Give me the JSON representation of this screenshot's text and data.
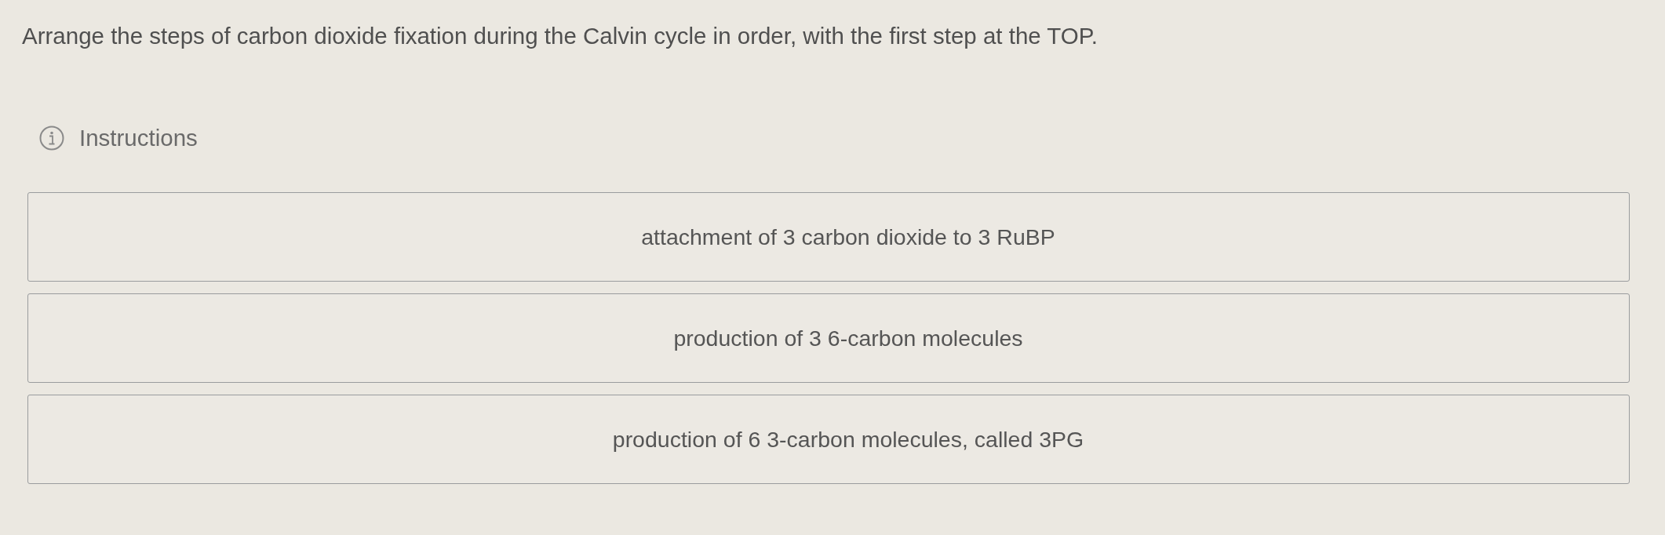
{
  "question": "Arrange the steps of carbon dioxide fixation during the Calvin cycle in order, with the first step at the TOP.",
  "instructions": {
    "label": "Instructions"
  },
  "steps": [
    {
      "text": "attachment of 3 carbon dioxide to 3 RuBP"
    },
    {
      "text": "production of 3 6-carbon molecules"
    },
    {
      "text": "production of 6 3-carbon molecules, called 3PG"
    }
  ]
}
